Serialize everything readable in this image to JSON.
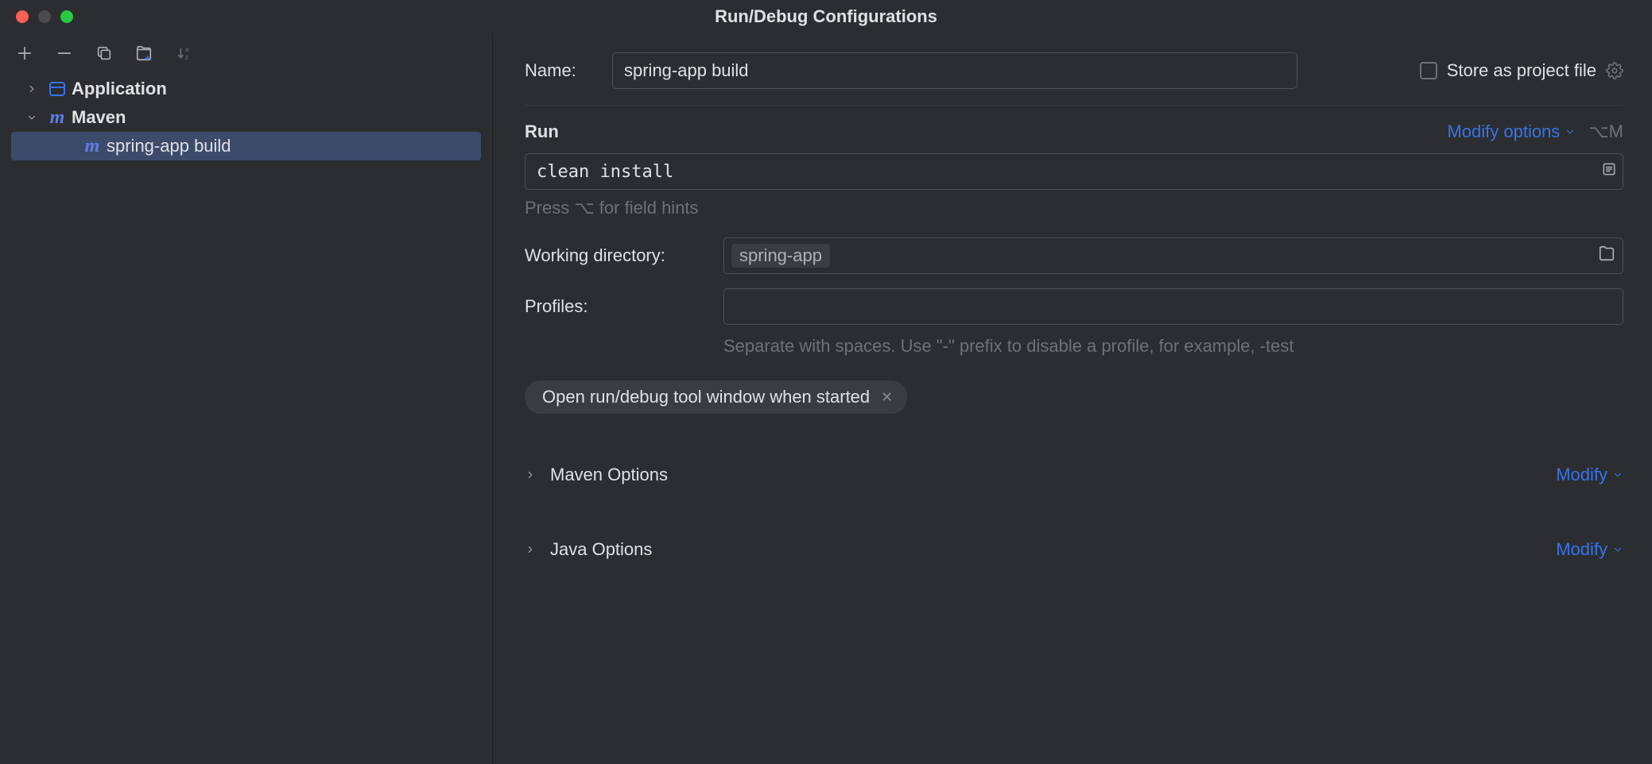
{
  "window": {
    "title": "Run/Debug Configurations"
  },
  "sidebar": {
    "items": [
      {
        "label": "Application",
        "expanded": false,
        "icon": "app"
      },
      {
        "label": "Maven",
        "expanded": true,
        "icon": "maven"
      },
      {
        "label": "spring-app build",
        "icon": "maven",
        "selected": true
      }
    ]
  },
  "form": {
    "name_label": "Name:",
    "name_value": "spring-app build",
    "store_label": "Store as project file",
    "run_section": "Run",
    "modify_options": "Modify options",
    "modify_shortcut": "⌥M",
    "command_value": "clean install",
    "command_hint": "Press ⌥ for field hints",
    "working_dir_label": "Working directory:",
    "working_dir_value": "spring-app",
    "profiles_label": "Profiles:",
    "profiles_value": "",
    "profiles_hint": "Separate with spaces. Use \"-\" prefix to disable a profile, for example, -test",
    "chip_label": "Open run/debug tool window when started",
    "maven_options": "Maven Options",
    "java_options": "Java Options",
    "modify": "Modify"
  }
}
